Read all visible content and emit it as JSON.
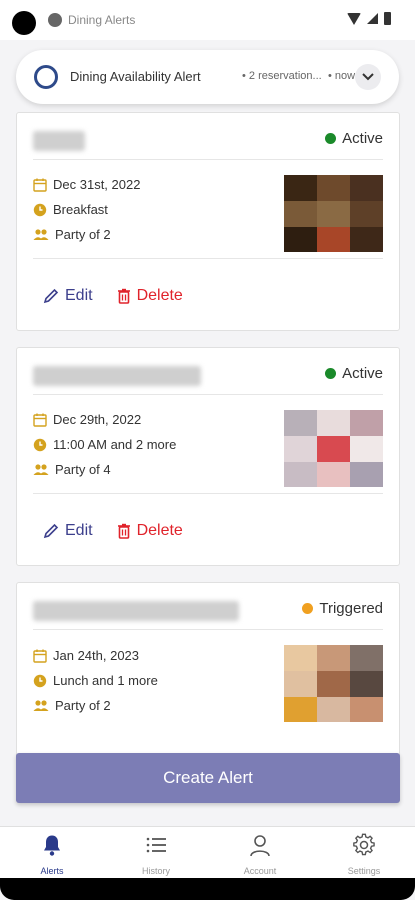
{
  "status_bar": {
    "app_name": "Dining Alerts"
  },
  "notification": {
    "title": "Dining Availability Alert",
    "separator": "•",
    "subtitle": "2 reservation...",
    "time": "• now"
  },
  "cards": [
    {
      "status": "Active",
      "status_color": "#1a8a2a",
      "date": "Dec 31st, 2022",
      "meal": "Breakfast",
      "party": "Party of 2",
      "edit_label": "Edit",
      "delete_label": "Delete"
    },
    {
      "status": "Active",
      "status_color": "#1a8a2a",
      "date": "Dec 29th, 2022",
      "meal": "11:00 AM and 2 more",
      "party": "Party of 4",
      "edit_label": "Edit",
      "delete_label": "Delete"
    },
    {
      "status": "Triggered",
      "status_color": "#f0a020",
      "date": "Jan 24th, 2023",
      "meal": "Lunch and 1 more",
      "party": "Party of 2"
    }
  ],
  "create_button": {
    "label": "Create Alert"
  },
  "bottom_nav": {
    "items": [
      {
        "label": "Alerts",
        "icon": "bell-icon"
      },
      {
        "label": "History",
        "icon": "list-icon"
      },
      {
        "label": "Account",
        "icon": "person-icon"
      },
      {
        "label": "Settings",
        "icon": "gear-icon"
      }
    ]
  },
  "colors": {
    "accent": "#7c7db5",
    "edit": "#3c3f8c",
    "delete": "#e0232b",
    "icon_gold": "#d4a21e"
  }
}
